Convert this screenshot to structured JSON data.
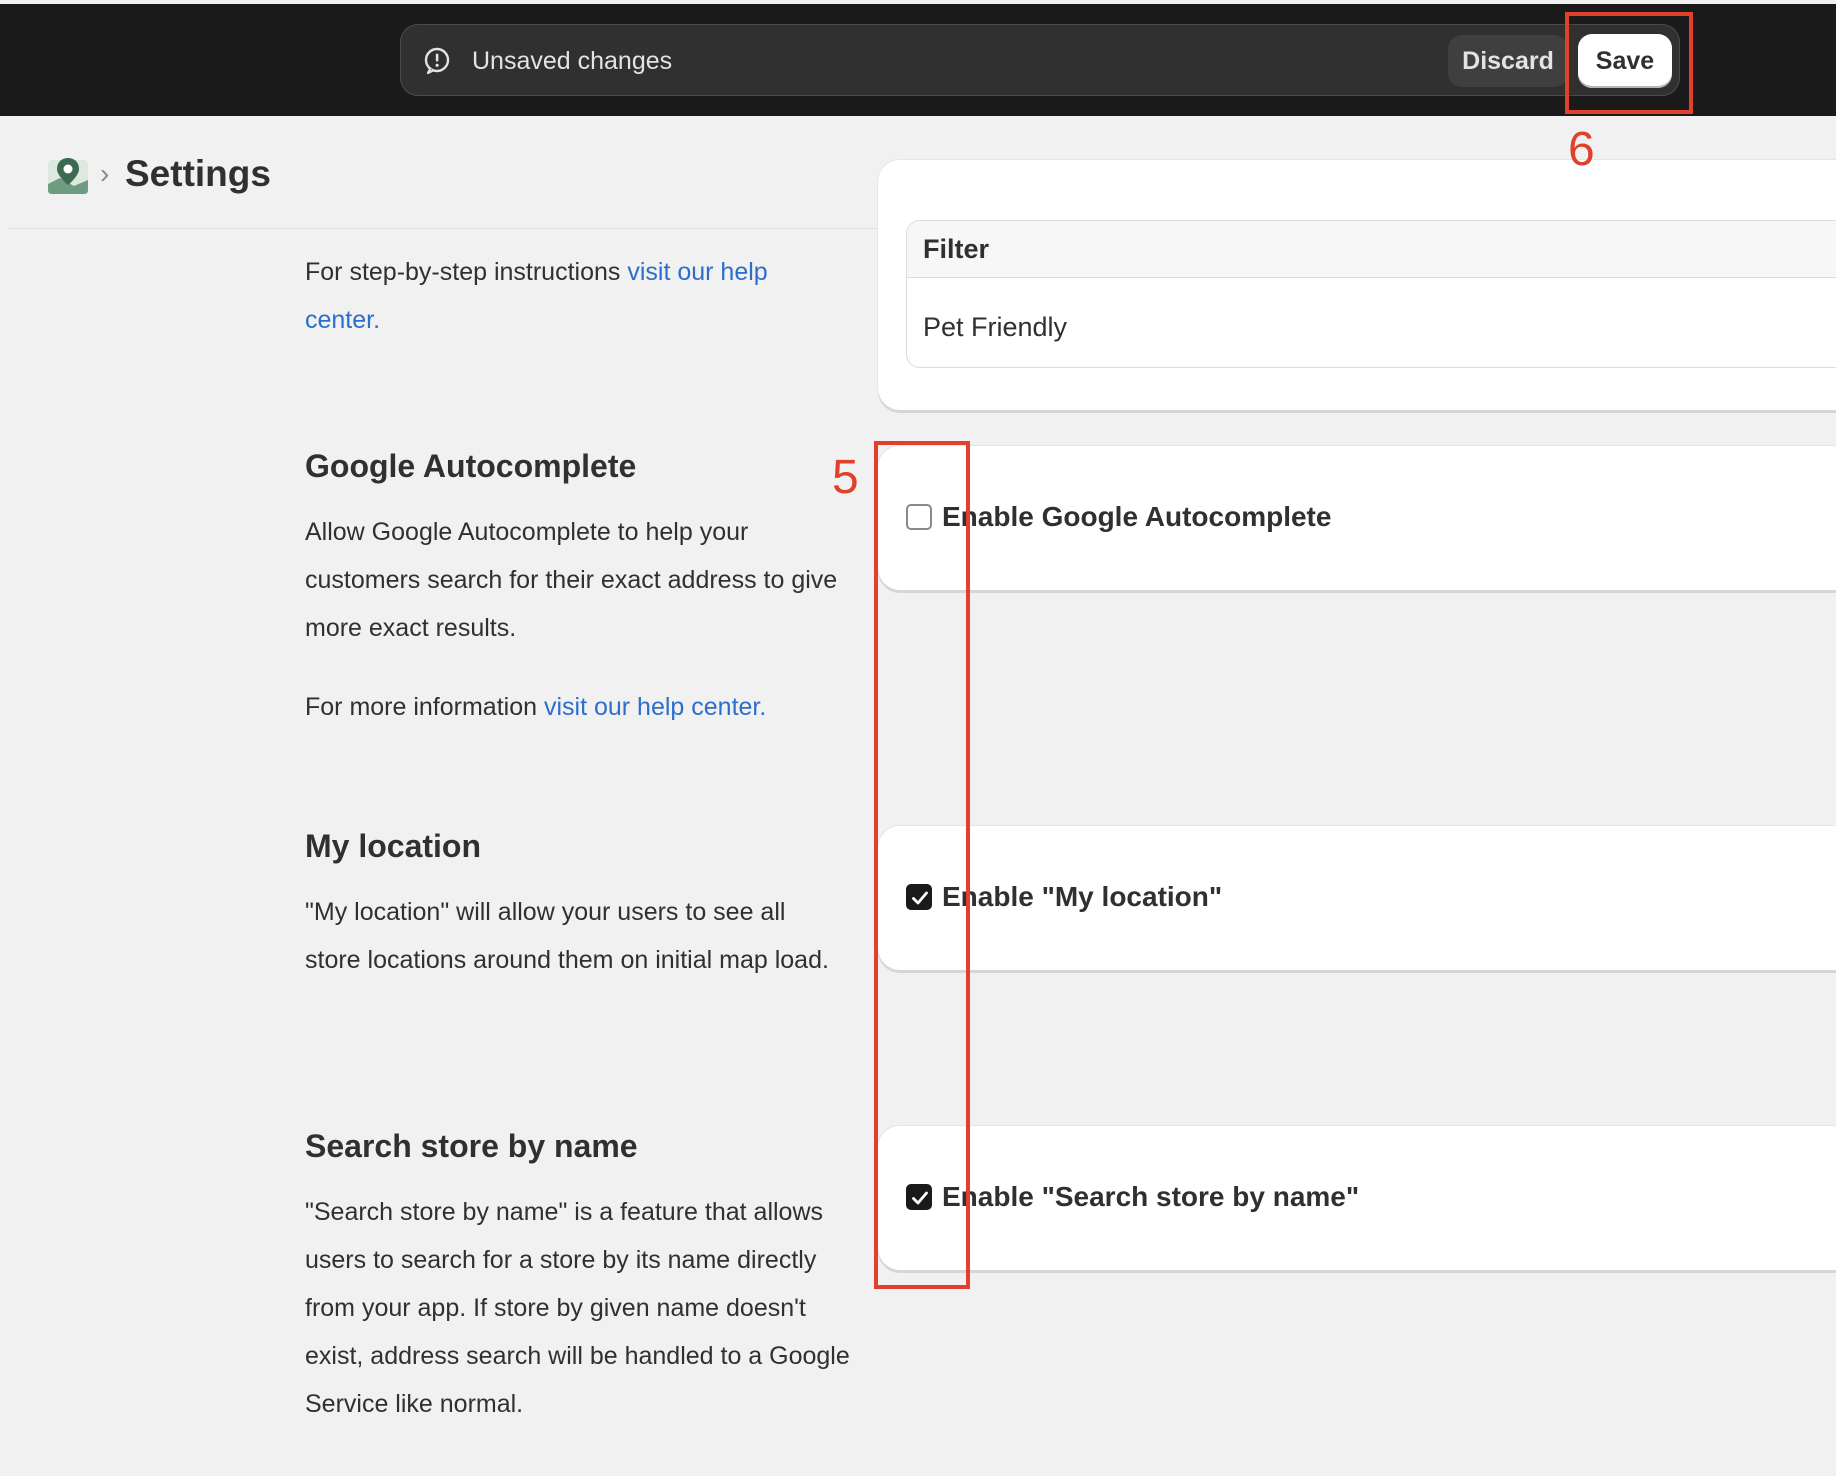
{
  "save_bar": {
    "message": "Unsaved changes",
    "discard_label": "Discard",
    "save_label": "Save"
  },
  "header": {
    "title": "Settings"
  },
  "filter_section": {
    "help_text": "For step-by-step instructions ",
    "help_link": "visit our help center.",
    "table_header": "Filter",
    "table_row": "Pet Friendly"
  },
  "google_autocomplete": {
    "title": "Google Autocomplete",
    "description": "Allow Google Autocomplete to help your customers search for their exact address to give more exact results.",
    "info_text": "For more information ",
    "info_link": "visit our help center.",
    "checkbox_label": "Enable Google Autocomplete",
    "checked": false
  },
  "my_location": {
    "title": "My location",
    "description": "\"My location\" will allow your users to see all store locations around them on initial map load.",
    "checkbox_label": "Enable \"My location\"",
    "checked": true
  },
  "search_by_name": {
    "title": "Search store by name",
    "description": "\"Search store by name\" is a feature that allows users to search for a store by its name directly from your app. If store by given name doesn't exist, address search will be handled to a Google Service like normal.",
    "checkbox_label": "Enable \"Search store by name\"",
    "checked": true
  },
  "annotations": {
    "save_marker": "6",
    "checkbox_marker": "5"
  },
  "colors": {
    "topbar": "#1a1a1a",
    "link": "#2c6ecb",
    "annotation": "#e0412b"
  },
  "icons": {
    "alert": "alert-circle-icon",
    "app": "map-pin-app-icon",
    "breadcrumb": "chevron-right-icon",
    "check": "checkmark-icon"
  }
}
